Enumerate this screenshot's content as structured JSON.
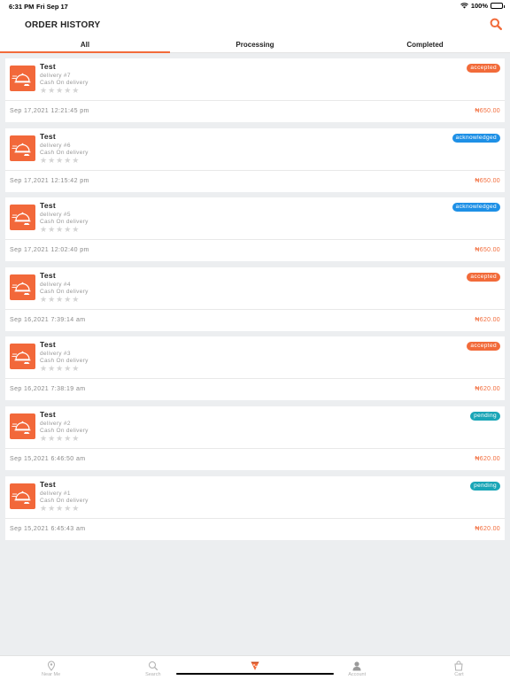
{
  "status_bar": {
    "time": "6:31 PM",
    "date": "Fri Sep 17",
    "battery": "100%"
  },
  "header": {
    "title": "ORDER HISTORY"
  },
  "tabs": [
    {
      "label": "All",
      "active": true
    },
    {
      "label": "Processing",
      "active": false
    },
    {
      "label": "Completed",
      "active": false
    }
  ],
  "orders": [
    {
      "name": "Test",
      "delivery": "delivery #7",
      "payment": "Cash On delivery",
      "stars": "★★★★★",
      "status": "accepted",
      "status_color": "#f26b3a",
      "time": "Sep 17,2021 12:21:45 pm",
      "price": "₦650.00"
    },
    {
      "name": "Test",
      "delivery": "delivery #6",
      "payment": "Cash On delivery",
      "stars": "★★★★★",
      "status": "acknowledged",
      "status_color": "#1e90e6",
      "time": "Sep 17,2021 12:15:42 pm",
      "price": "₦650.00"
    },
    {
      "name": "Test",
      "delivery": "delivery #5",
      "payment": "Cash On delivery",
      "stars": "★★★★★",
      "status": "acknowledged",
      "status_color": "#1e90e6",
      "time": "Sep 17,2021 12:02:40 pm",
      "price": "₦650.00"
    },
    {
      "name": "Test",
      "delivery": "delivery #4",
      "payment": "Cash On delivery",
      "stars": "★★★★★",
      "status": "accepted",
      "status_color": "#f26b3a",
      "time": "Sep 16,2021 7:39:14 am",
      "price": "₦620.00"
    },
    {
      "name": "Test",
      "delivery": "delivery #3",
      "payment": "Cash On delivery",
      "stars": "★★★★★",
      "status": "accepted",
      "status_color": "#f26b3a",
      "time": "Sep 16,2021 7:38:19 am",
      "price": "₦620.00"
    },
    {
      "name": "Test",
      "delivery": "delivery #2",
      "payment": "Cash On delivery",
      "stars": "★★★★★",
      "status": "pending",
      "status_color": "#1aa6b7",
      "time": "Sep 15,2021 6:46:50 am",
      "price": "₦620.00"
    },
    {
      "name": "Test",
      "delivery": "delivery #1",
      "payment": "Cash On delivery",
      "stars": "★★★★★",
      "status": "pending",
      "status_color": "#1aa6b7",
      "time": "Sep 15,2021 6:45:43 am",
      "price": "₦620.00"
    }
  ],
  "bottom_nav": [
    {
      "label": "Near Me",
      "icon": "location-pin-icon"
    },
    {
      "label": "Search",
      "icon": "search-icon"
    },
    {
      "label": "",
      "icon": "pizza-icon",
      "active": true
    },
    {
      "label": "Account",
      "icon": "account-icon"
    },
    {
      "label": "Cart",
      "icon": "cart-icon"
    }
  ],
  "colors": {
    "accent": "#f26b3a",
    "acknowledged": "#1e90e6",
    "pending": "#1aa6b7",
    "background": "#eceef0"
  }
}
